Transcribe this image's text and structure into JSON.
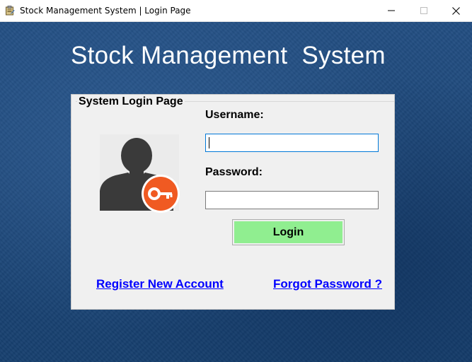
{
  "window": {
    "title": "Stock Management System | Login Page",
    "app_icon": "clipboard-icon",
    "controls": [
      "minimize-icon",
      "maximize-icon",
      "close-icon"
    ]
  },
  "main": {
    "heading": "Stock Management  System"
  },
  "login_panel": {
    "group_title": "System Login Page",
    "avatar_icon": "user-key-icon",
    "username": {
      "label": "Username:",
      "value": ""
    },
    "password": {
      "label": "Password:",
      "value": ""
    },
    "login_button": "Login",
    "links": {
      "register": "Register New Account",
      "forgot": "Forgot Password ?"
    }
  },
  "colors": {
    "background_blue": "#1f4a7c",
    "panel_gray": "#f0f0f0",
    "login_button_green": "#90ee90",
    "link_blue": "#0000ff",
    "key_badge_orange": "#f05a22",
    "input_focus_border": "#0078d7"
  }
}
